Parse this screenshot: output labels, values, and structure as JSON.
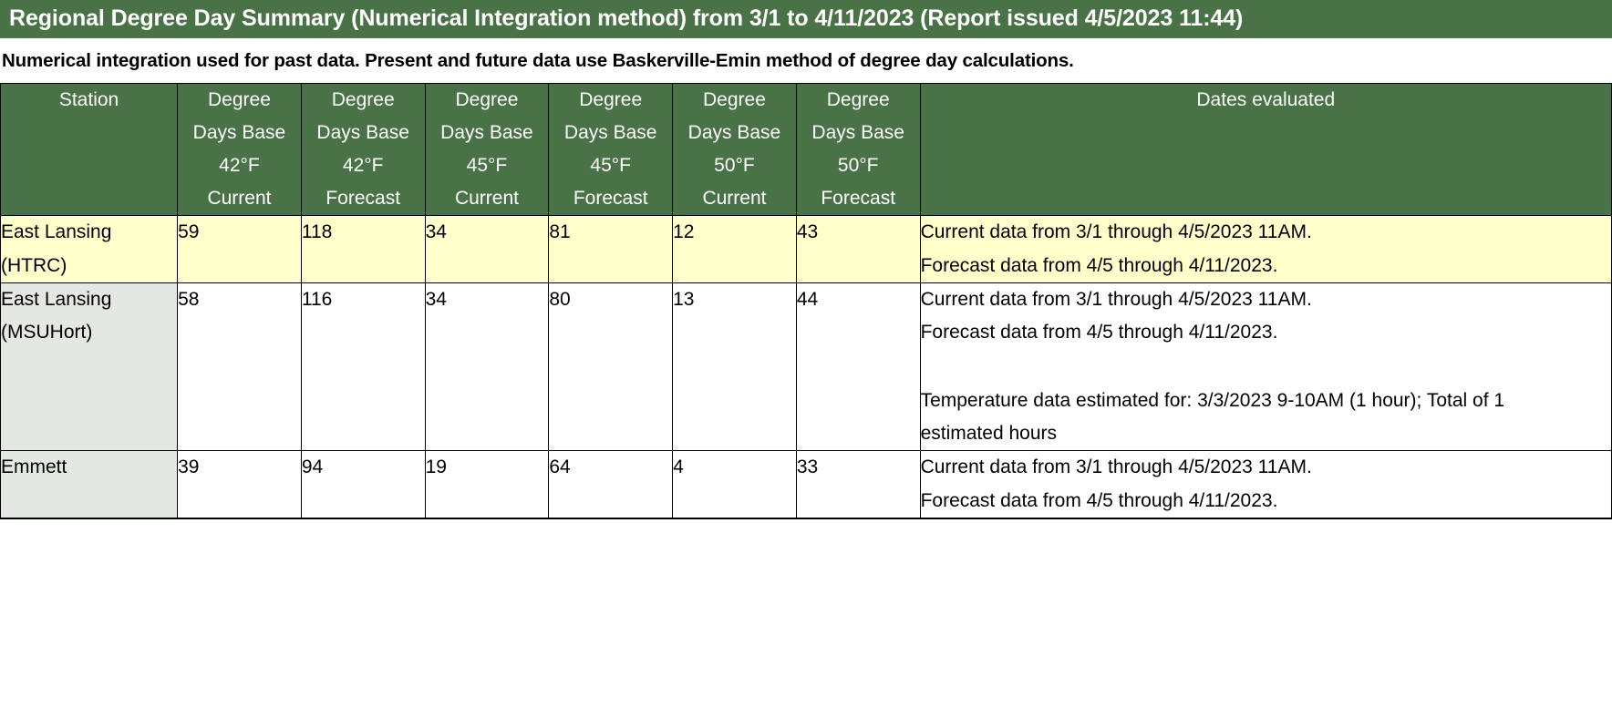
{
  "page": {
    "title": "Regional Degree Day Summary (Numerical Integration method) from 3/1 to 4/11/2023 (Report issued 4/5/2023 11:44)",
    "intro_note": "Numerical integration used for past data. Present and future data use Baskerville-Emin method of degree day calculations."
  },
  "colors": {
    "header_green": "#4a7247",
    "highlight_yellow": "#ffffcc",
    "station_gray": "#e3e8e0"
  },
  "table": {
    "columns": [
      {
        "id": "station",
        "lines": [
          "Station"
        ]
      },
      {
        "id": "dd42cur",
        "lines": [
          "Degree",
          "Days Base",
          "42°F",
          "Current"
        ]
      },
      {
        "id": "dd42fc",
        "lines": [
          "Degree",
          "Days Base",
          "42°F",
          "Forecast"
        ]
      },
      {
        "id": "dd45cur",
        "lines": [
          "Degree",
          "Days Base",
          "45°F",
          "Current"
        ]
      },
      {
        "id": "dd45fc",
        "lines": [
          "Degree",
          "Days Base",
          "45°F",
          "Forecast"
        ]
      },
      {
        "id": "dd50cur",
        "lines": [
          "Degree",
          "Days Base",
          "50°F",
          "Current"
        ]
      },
      {
        "id": "dd50fc",
        "lines": [
          "Degree",
          "Days Base",
          "50°F",
          "Forecast"
        ]
      },
      {
        "id": "dates",
        "lines": [
          "Dates evaluated"
        ]
      }
    ],
    "rows": [
      {
        "highlight": true,
        "station_lines": [
          "East Lansing",
          "(HTRC)"
        ],
        "values": [
          "59",
          "118",
          "34",
          "81",
          "12",
          "43"
        ],
        "notes": [
          "Current data from 3/1 through 4/5/2023 11AM.",
          "Forecast data from 4/5 through 4/11/2023."
        ],
        "extra_notes": []
      },
      {
        "highlight": false,
        "station_lines": [
          "East Lansing",
          "(MSUHort)"
        ],
        "values": [
          "58",
          "116",
          "34",
          "80",
          "13",
          "44"
        ],
        "notes": [
          "Current data from 3/1 through 4/5/2023 11AM.",
          "Forecast data from 4/5 through 4/11/2023."
        ],
        "extra_notes": [
          "Temperature data estimated for: 3/3/2023 9-10AM (1 hour); Total of 1",
          "estimated hours"
        ]
      },
      {
        "highlight": false,
        "station_lines": [
          "Emmett"
        ],
        "values": [
          "39",
          "94",
          "19",
          "64",
          "4",
          "33"
        ],
        "notes": [
          "Current data from 3/1 through 4/5/2023 11AM.",
          "Forecast data from 4/5 through 4/11/2023."
        ],
        "extra_notes": []
      },
      {
        "highlight": false,
        "station_lines": [
          ""
        ],
        "values": [
          "",
          "",
          "",
          "",
          "",
          ""
        ],
        "notes": [],
        "extra_notes": []
      }
    ]
  }
}
